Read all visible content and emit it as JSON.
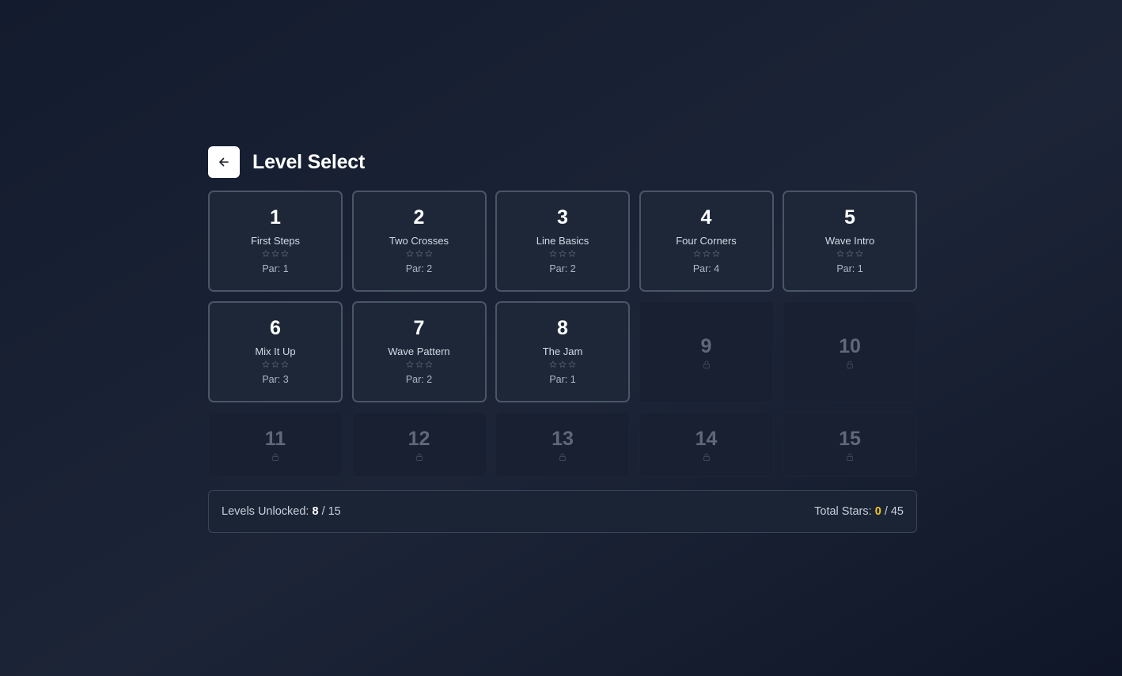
{
  "header": {
    "title": "Level Select",
    "back_icon": "arrow-left-icon"
  },
  "levels": [
    {
      "number": "1",
      "name": "First Steps",
      "par": "Par: 1",
      "stars": 0,
      "locked": false
    },
    {
      "number": "2",
      "name": "Two Crosses",
      "par": "Par: 2",
      "stars": 0,
      "locked": false
    },
    {
      "number": "3",
      "name": "Line Basics",
      "par": "Par: 2",
      "stars": 0,
      "locked": false
    },
    {
      "number": "4",
      "name": "Four Corners",
      "par": "Par: 4",
      "stars": 0,
      "locked": false
    },
    {
      "number": "5",
      "name": "Wave Intro",
      "par": "Par: 1",
      "stars": 0,
      "locked": false
    },
    {
      "number": "6",
      "name": "Mix It Up",
      "par": "Par: 3",
      "stars": 0,
      "locked": false
    },
    {
      "number": "7",
      "name": "Wave Pattern",
      "par": "Par: 2",
      "stars": 0,
      "locked": false
    },
    {
      "number": "8",
      "name": "The Jam",
      "par": "Par: 1",
      "stars": 0,
      "locked": false
    },
    {
      "number": "9",
      "locked": true
    },
    {
      "number": "10",
      "locked": true
    },
    {
      "number": "11",
      "locked": true
    },
    {
      "number": "12",
      "locked": true
    },
    {
      "number": "13",
      "locked": true
    },
    {
      "number": "14",
      "locked": true
    },
    {
      "number": "15",
      "locked": true
    }
  ],
  "footer": {
    "unlocked_label": "Levels Unlocked:",
    "unlocked_count": "8",
    "unlocked_total": "/ 15",
    "stars_label": "Total Stars:",
    "stars_count": "0",
    "stars_total": "/ 45"
  },
  "colors": {
    "star_gold": "#f5c518",
    "card_border": "#4a5567",
    "background": "#1a2234"
  }
}
